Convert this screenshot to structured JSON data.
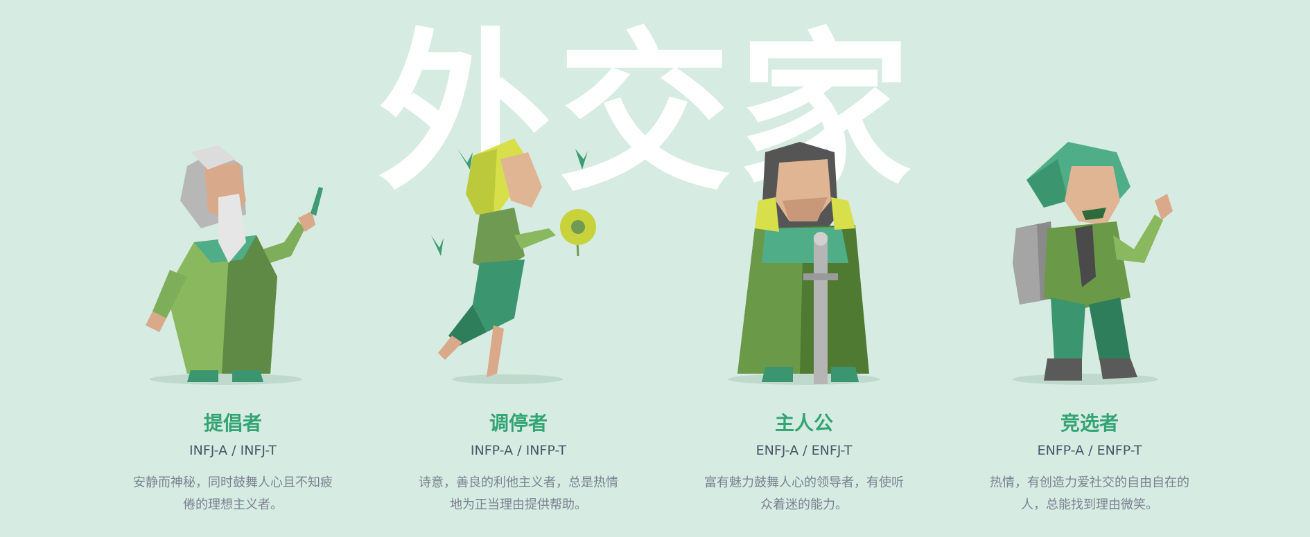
{
  "section": {
    "title": "外交家"
  },
  "cards": [
    {
      "name": "提倡者",
      "code": "INFJ-A / INFJ-T",
      "desc": "安静而神秘，同时鼓舞人心且不知疲倦的理想主义者。"
    },
    {
      "name": "调停者",
      "code": "INFP-A / INFP-T",
      "desc": "诗意，善良的利他主义者，总是热情地为正当理由提供帮助。"
    },
    {
      "name": "主人公",
      "code": "ENFJ-A / ENFJ-T",
      "desc": "富有魅力鼓舞人心的领导者，有使听众着迷的能力。"
    },
    {
      "name": "竞选者",
      "code": "ENFP-A / ENFP-T",
      "desc": "热情，有创造力爱社交的自由自在的人，总能找到理由微笑。"
    }
  ],
  "colors": {
    "background": "#d6ebe2",
    "accent": "#33a474",
    "title": "#ffffff",
    "code": "#4a5565",
    "description": "#7a8390"
  },
  "icons": [
    "advocate-illustration",
    "mediator-illustration",
    "protagonist-illustration",
    "campaigner-illustration"
  ]
}
